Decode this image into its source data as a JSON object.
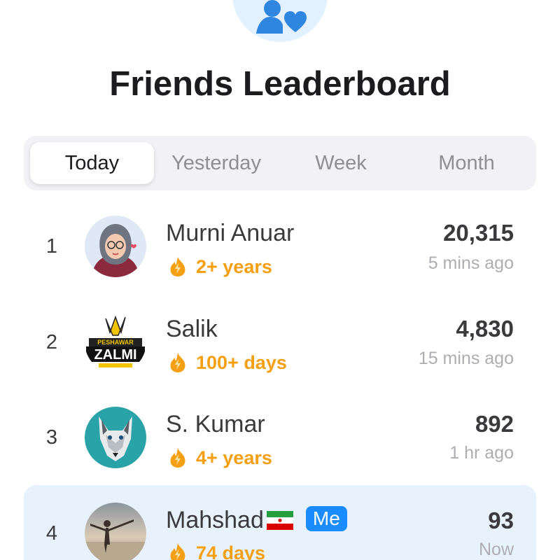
{
  "header": {
    "icon": "friends-heart-icon",
    "title": "Friends Leaderboard"
  },
  "tabs": [
    {
      "label": "Today",
      "active": true
    },
    {
      "label": "Yesterday",
      "active": false
    },
    {
      "label": "Week",
      "active": false
    },
    {
      "label": "Month",
      "active": false
    }
  ],
  "entries": [
    {
      "rank": "1",
      "name": "Murni Anuar",
      "streak": "2+ years",
      "score": "20,315",
      "time": "5 mins ago",
      "avatar": "hijab-girl-avatar"
    },
    {
      "rank": "2",
      "name": "Salik",
      "streak": "100+ days",
      "score": "4,830",
      "time": "15 mins ago",
      "avatar": "peshawar-zalmi-logo-avatar"
    },
    {
      "rank": "3",
      "name": "S. Kumar",
      "streak": "4+ years",
      "score": "892",
      "time": "1 hr ago",
      "avatar": "wolf-avatar"
    },
    {
      "rank": "4",
      "name": "Mahshad",
      "flag": "iran-flag",
      "badge": "Me",
      "streak": "74 days",
      "score": "93",
      "time": "Now",
      "avatar": "beach-photo-avatar",
      "is_me": true
    }
  ],
  "colors": {
    "accent": "#1a8cff",
    "streak": "#f5a012",
    "me_row_bg": "#e8f2fd",
    "segmented_bg": "#f1f1f6"
  }
}
